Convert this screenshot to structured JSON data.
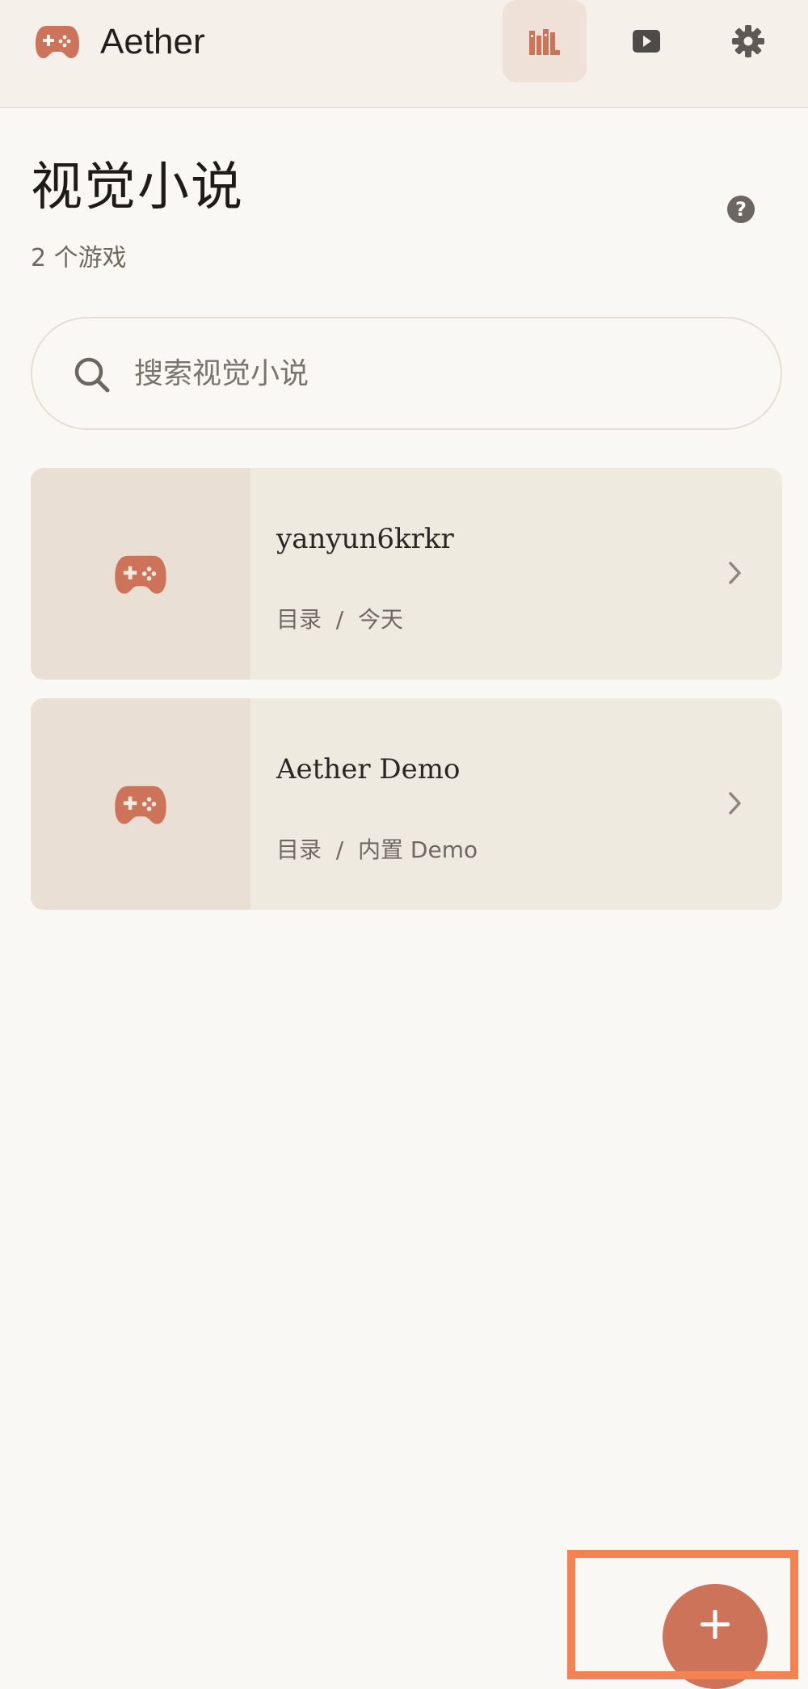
{
  "app": {
    "title": "Aether",
    "brand_icon": "gamepad-icon",
    "accent_color": "#CC735A"
  },
  "nav": {
    "items": [
      {
        "name": "library",
        "icon": "library-icon",
        "active": true
      },
      {
        "name": "play",
        "icon": "play-icon",
        "active": false
      },
      {
        "name": "settings",
        "icon": "gear-icon",
        "active": false
      }
    ]
  },
  "page": {
    "title": "视觉小说",
    "count": "2 个游戏",
    "help_label": "?"
  },
  "search": {
    "placeholder": "搜索视觉小说",
    "value": ""
  },
  "games": [
    {
      "title": "yanyun6krkr",
      "meta": "目录  /  今天",
      "thumb_icon": "gamepad-icon"
    },
    {
      "title": "Aether Demo",
      "meta": "目录  /  内置 Demo",
      "thumb_icon": "gamepad-icon"
    }
  ],
  "fab": {
    "icon": "plus-icon",
    "highlight_color": "#F58352"
  }
}
